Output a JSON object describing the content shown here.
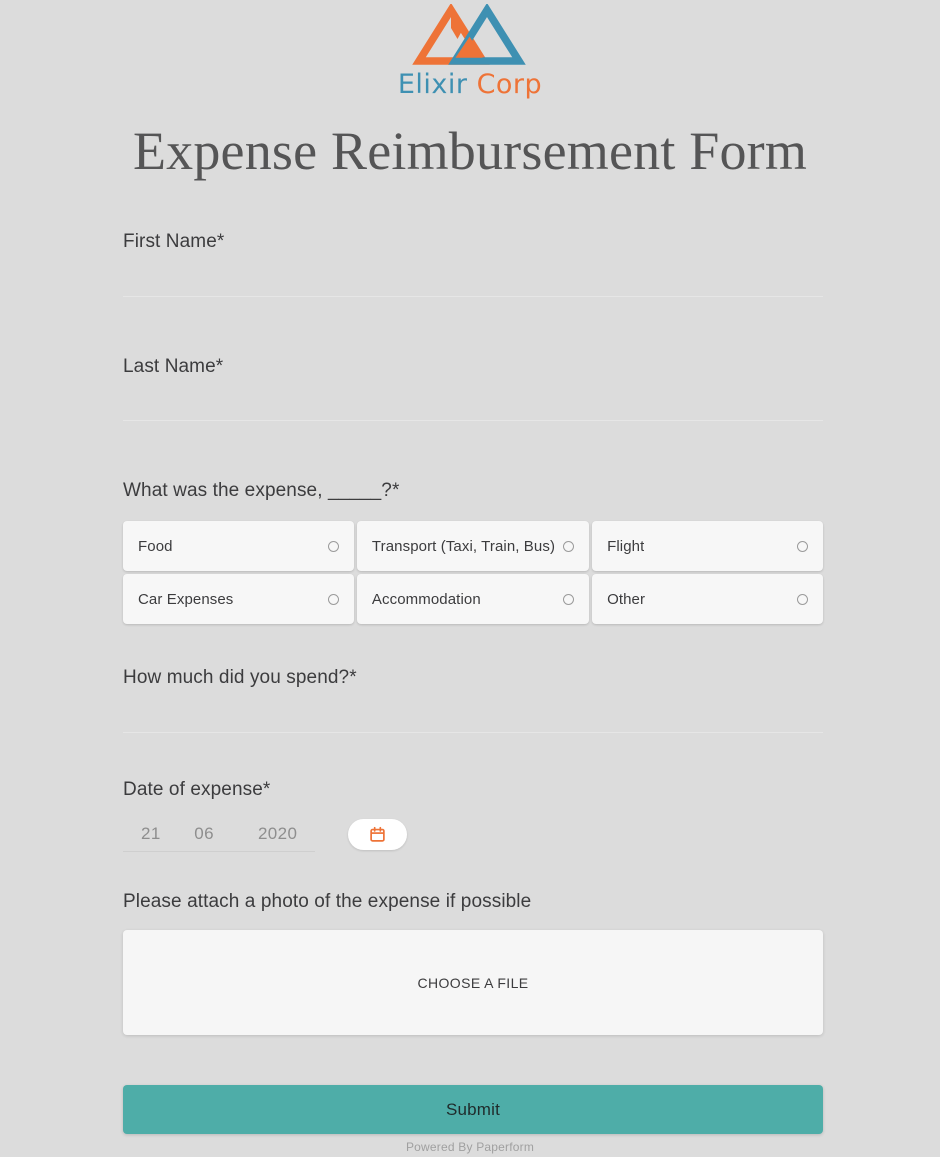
{
  "brand": {
    "logo_icon": "interlocking-triangles-logo",
    "name_part1": "Elixir",
    "name_part2": "Corp",
    "color_teal": "#3e90b2",
    "color_orange": "#ee7337"
  },
  "header": {
    "title": "Expense Reimbursement Form"
  },
  "fields": {
    "first_name": {
      "label": "First Name*",
      "value": "",
      "placeholder": ""
    },
    "last_name": {
      "label": "Last Name*",
      "value": "",
      "placeholder": ""
    },
    "expense_type": {
      "label": "What was the expense, _____?*",
      "options": [
        {
          "label": "Food",
          "selected": false
        },
        {
          "label": "Transport (Taxi, Train, Bus)",
          "selected": false
        },
        {
          "label": "Flight",
          "selected": false
        },
        {
          "label": "Car Expenses",
          "selected": false
        },
        {
          "label": "Accommodation",
          "selected": false
        },
        {
          "label": "Other",
          "selected": false
        }
      ]
    },
    "amount": {
      "label": "How much did you spend?*",
      "value": "",
      "placeholder": ""
    },
    "date": {
      "label": "Date of expense*",
      "day": "21",
      "month": "06",
      "year": "2020",
      "calendar_icon": "calendar-icon",
      "calendar_icon_color": "#ee7337"
    },
    "attachment": {
      "label": "Please attach a photo of the expense if possible",
      "button_label": "CHOOSE A FILE"
    }
  },
  "actions": {
    "submit_label": "Submit",
    "submit_color": "#4eada8"
  },
  "footer": {
    "text": "Powered By Paperform"
  }
}
